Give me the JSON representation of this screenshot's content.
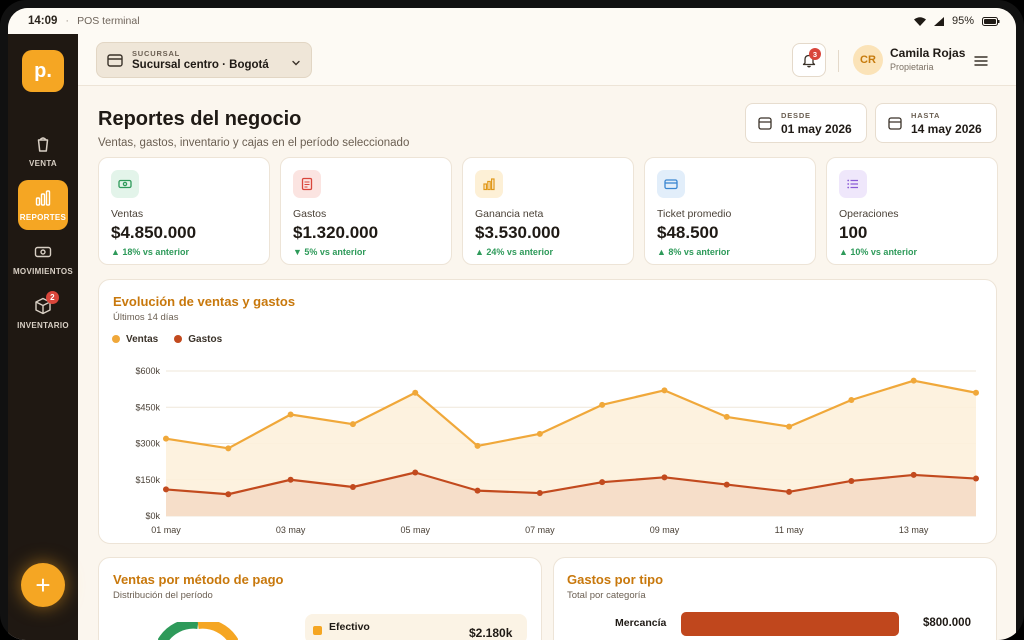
{
  "statusbar": {
    "time": "14:09",
    "app": "POS terminal",
    "battery": "95%"
  },
  "sidebar": {
    "logo": "p.",
    "items": [
      {
        "label": "VENTA",
        "icon": "cup-icon"
      },
      {
        "label": "REPORTES",
        "icon": "bar-chart-icon"
      },
      {
        "label": "MOVIMIENTOS",
        "icon": "cash-icon"
      },
      {
        "label": "INVENTARIO",
        "icon": "box-icon",
        "badge": "2"
      }
    ],
    "fab": "+"
  },
  "header": {
    "branch_label": "SUCURSAL",
    "branch_value": "Sucursal centro · Bogotá",
    "notifications": "3",
    "avatar": "CR",
    "user_name": "Camila Rojas",
    "user_role": "Propietaria"
  },
  "page": {
    "title": "Reportes del negocio",
    "subtitle": "Ventas, gastos, inventario y cajas en el período seleccionado",
    "from_label": "DESDE",
    "from_value": "01 may 2026",
    "to_label": "HASTA",
    "to_value": "14 may 2026"
  },
  "kpis": [
    {
      "label": "Ventas",
      "value": "$4.850.000",
      "delta": "▲ 18% vs anterior",
      "icon": "cash-icon",
      "color": "#2e9a5a",
      "bg": "#e3f4ea"
    },
    {
      "label": "Gastos",
      "value": "$1.320.000",
      "delta": "▼ 5% vs anterior",
      "icon": "receipt-icon",
      "color": "#d9463b",
      "bg": "#fbe4e1"
    },
    {
      "label": "Ganancia neta",
      "value": "$3.530.000",
      "delta": "▲ 24% vs anterior",
      "icon": "bar-chart-icon",
      "color": "#e0981a",
      "bg": "#fdf0d6"
    },
    {
      "label": "Ticket promedio",
      "value": "$48.500",
      "delta": "▲ 8% vs anterior",
      "icon": "card-icon",
      "color": "#3a86d1",
      "bg": "#e2eefa"
    },
    {
      "label": "Operaciones",
      "value": "100",
      "delta": "▲ 10% vs anterior",
      "icon": "list-icon",
      "color": "#8a5bd6",
      "bg": "#efe7fb"
    }
  ],
  "trend": {
    "title": "Evolución de ventas y gastos",
    "subtitle": "Últimos 14 días"
  },
  "chart_data": {
    "type": "area",
    "x": [
      "01 may",
      "02 may",
      "03 may",
      "04 may",
      "05 may",
      "06 may",
      "07 may",
      "08 may",
      "09 may",
      "10 may",
      "11 may",
      "12 may",
      "13 may",
      "14 may"
    ],
    "x_tick_labels": [
      "01 may",
      "03 may",
      "05 may",
      "07 may",
      "09 may",
      "11 may",
      "13 may"
    ],
    "series": [
      {
        "name": "Ventas",
        "color": "#f0a83a",
        "values": [
          320000,
          280000,
          420000,
          380000,
          510000,
          290000,
          340000,
          460000,
          520000,
          410000,
          370000,
          480000,
          560000,
          510000
        ]
      },
      {
        "name": "Gastos",
        "color": "#c24a1e",
        "values": [
          110000,
          90000,
          150000,
          120000,
          180000,
          105000,
          95000,
          140000,
          160000,
          130000,
          100000,
          145000,
          170000,
          155000
        ]
      }
    ],
    "y_ticks": [
      "$0k",
      "$150k",
      "$300k",
      "$450k",
      "$600k"
    ],
    "ylim": [
      0,
      600000
    ],
    "grid": true,
    "legend": "top-left"
  },
  "payments": {
    "title": "Ventas por método de pago",
    "subtitle": "Distribución del período",
    "items": [
      {
        "name": "Efectivo",
        "value": "$2.180k"
      }
    ]
  },
  "expenses": {
    "title": "Gastos por tipo",
    "subtitle": "Total por categoría",
    "items": [
      {
        "name": "Mercancía",
        "value": "$800.000",
        "share": 0.85
      }
    ]
  }
}
